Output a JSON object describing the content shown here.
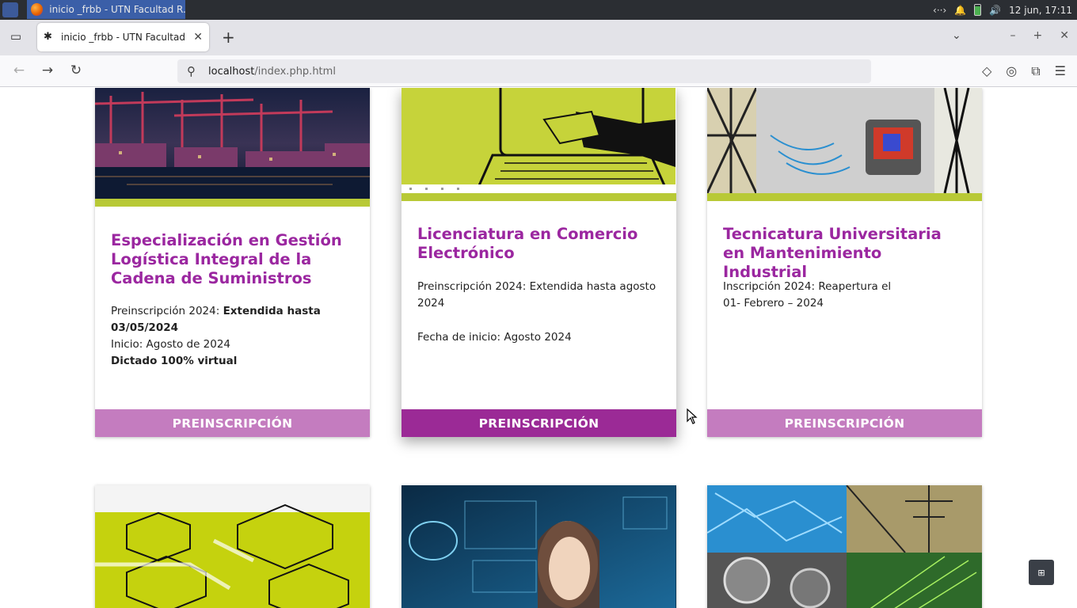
{
  "os": {
    "task_title": "inicio _frbb - UTN Facultad R...",
    "clock": "12 jun, 17:11",
    "tray_network": "‹··›"
  },
  "browser": {
    "tab_title": "inicio _frbb - UTN Facultad Re",
    "tab_favicon": "✱",
    "url_host": "localhost",
    "url_path": "/index.php.html"
  },
  "cards": [
    {
      "title": "Especialización en Gestión Logística Integral de la Cadena de Suministros",
      "line1_label": "Preinscripción 2024: ",
      "line1_bold": "Extendida  hasta 03/05/2024",
      "line2": "Inicio:  Agosto de 2024",
      "line3_bold": "Dictado 100% virtual",
      "button": "PREINSCRIPCIÓN"
    },
    {
      "title": "Licenciatura en Comercio Electrónico",
      "line1": "Preinscripción 2024: Extendida hasta agosto 2024",
      "line2": "Fecha de inicio: Agosto 2024",
      "button": "PREINSCRIPCIÓN"
    },
    {
      "title": "Tecnicatura Universitaria en Mantenimiento Industrial",
      "line1": "Inscripción 2024: Reapertura el",
      "line2": "01- Febrero – 2024",
      "button": "PREINSCRIPCIÓN"
    }
  ],
  "colors": {
    "accent_purple": "#9b27a0",
    "button_light": "#c47cbf",
    "button_active": "#9b2a96",
    "lime": "#b8c936"
  }
}
